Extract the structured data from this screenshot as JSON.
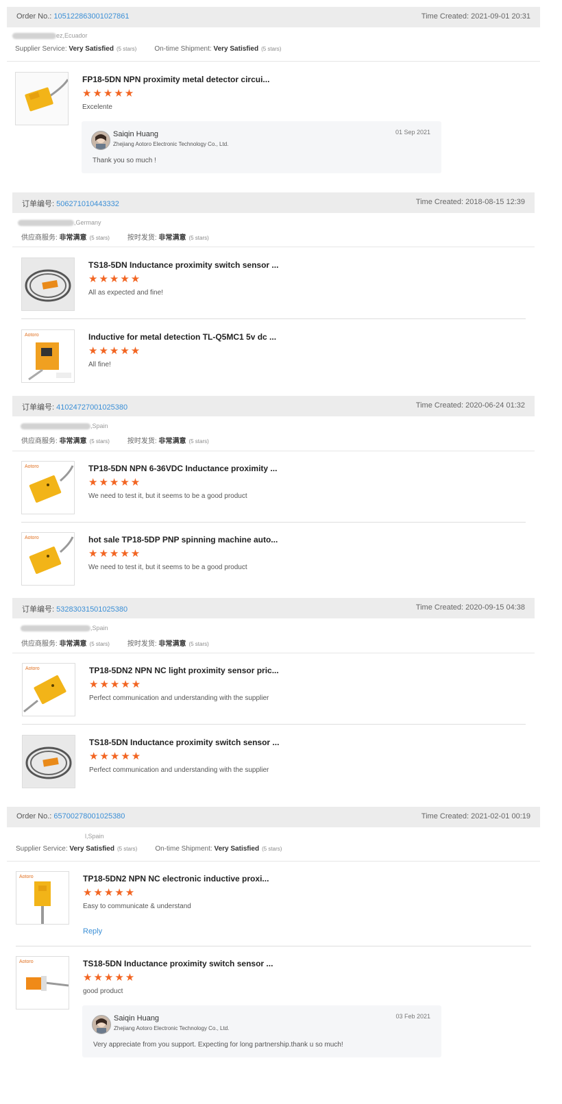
{
  "orders": [
    {
      "label": "Order No.:",
      "number": "105122863001027861",
      "time": "Time Created: 2021-09-01 20:31",
      "buyer_suffix": "ez,Ecuador",
      "supplier_label": "Supplier Service:",
      "supplier_value": "Very Satisfied",
      "supplier_stars": "(5 stars)",
      "shipment_label": "On-time Shipment:",
      "shipment_value": "Very Satisfied",
      "shipment_stars": "(5 stars)",
      "products": [
        {
          "title": "FP18-5DN NPN proximity metal detector circui...",
          "stars": "★★★★★",
          "comment": "Excelente",
          "reply": {
            "name": "Saiqin Huang",
            "company": "Zhejiang Aotoro Electronic Technology Co., Ltd.",
            "date": "01 Sep 2021",
            "text": "Thank you so much !"
          }
        }
      ]
    },
    {
      "label": "订单编号:",
      "number": "506271010443332",
      "time": "Time Created: 2018-08-15 12:39",
      "buyer_suffix": ",Germany",
      "supplier_label": "供应商服务:",
      "supplier_value": "非常满意",
      "supplier_stars": "(5 stars)",
      "shipment_label": "按时发货:",
      "shipment_value": "非常满意",
      "shipment_stars": "(5 stars)",
      "products": [
        {
          "title": "TS18-5DN Inductance proximity switch sensor ...",
          "stars": "★★★★★",
          "comment": "All as expected and fine!"
        },
        {
          "title": "Inductive for metal detection TL-Q5MC1 5v dc ...",
          "stars": "★★★★★",
          "comment": "All fine!"
        }
      ]
    },
    {
      "label": "订单编号:",
      "number": "41024727001025380",
      "time": "Time Created: 2020-06-24 01:32",
      "buyer_suffix": ",Spain",
      "supplier_label": "供应商服务:",
      "supplier_value": "非常满意",
      "supplier_stars": "(5 stars)",
      "shipment_label": "按时发货:",
      "shipment_value": "非常满意",
      "shipment_stars": "(5 stars)",
      "products": [
        {
          "title": "TP18-5DN NPN 6-36VDC Inductance proximity ...",
          "stars": "★★★★★",
          "comment": "We need to test it, but it seems to be a good product"
        },
        {
          "title": "hot sale TP18-5DP PNP spinning machine auto...",
          "stars": "★★★★★",
          "comment": "We need to test it, but it seems to be a good product"
        }
      ]
    },
    {
      "label": "订单编号:",
      "number": "53283031501025380",
      "time": "Time Created: 2020-09-15 04:38",
      "buyer_suffix": ",Spain",
      "supplier_label": "供应商服务:",
      "supplier_value": "非常满意",
      "supplier_stars": "(5 stars)",
      "shipment_label": "按时发货:",
      "shipment_value": "非常满意",
      "shipment_stars": "(5 stars)",
      "products": [
        {
          "title": "TP18-5DN2 NPN NC light proximity sensor pric...",
          "stars": "★★★★★",
          "comment": "Perfect communication and understanding with the supplier"
        },
        {
          "title": "TS18-5DN Inductance proximity switch sensor ...",
          "stars": "★★★★★",
          "comment": "Perfect communication and understanding with the supplier"
        }
      ]
    },
    {
      "label": "Order No.:",
      "number": "65700278001025380",
      "time": "Time Created: 2021-02-01 00:19",
      "buyer_suffix": "l,Spain",
      "supplier_label": "Supplier Service:",
      "supplier_value": "Very Satisfied",
      "supplier_stars": "(5 stars)",
      "shipment_label": "On-time Shipment:",
      "shipment_value": "Very Satisfied",
      "shipment_stars": "(5 stars)",
      "products": [
        {
          "title": "TP18-5DN2 NPN NC electronic inductive proxi...",
          "stars": "★★★★★",
          "comment": "Easy to communicate & understand",
          "reply_link": "Reply"
        },
        {
          "title": "TS18-5DN Inductance proximity switch sensor ...",
          "stars": "★★★★★",
          "comment": "good product",
          "reply": {
            "name": "Saiqin Huang",
            "company": "Zhejiang Aotoro Electronic Technology Co., Ltd.",
            "date": "03 Feb 2021",
            "text": "Very appreciate from you support. Expecting for long partnership.thank u so much!"
          }
        }
      ]
    }
  ],
  "brand_text": "Aotoro",
  "colors": {
    "star": "#f26522",
    "link": "#3b8fd6",
    "header_bg": "#ececec",
    "sensor_yellow": "#f2b418"
  }
}
